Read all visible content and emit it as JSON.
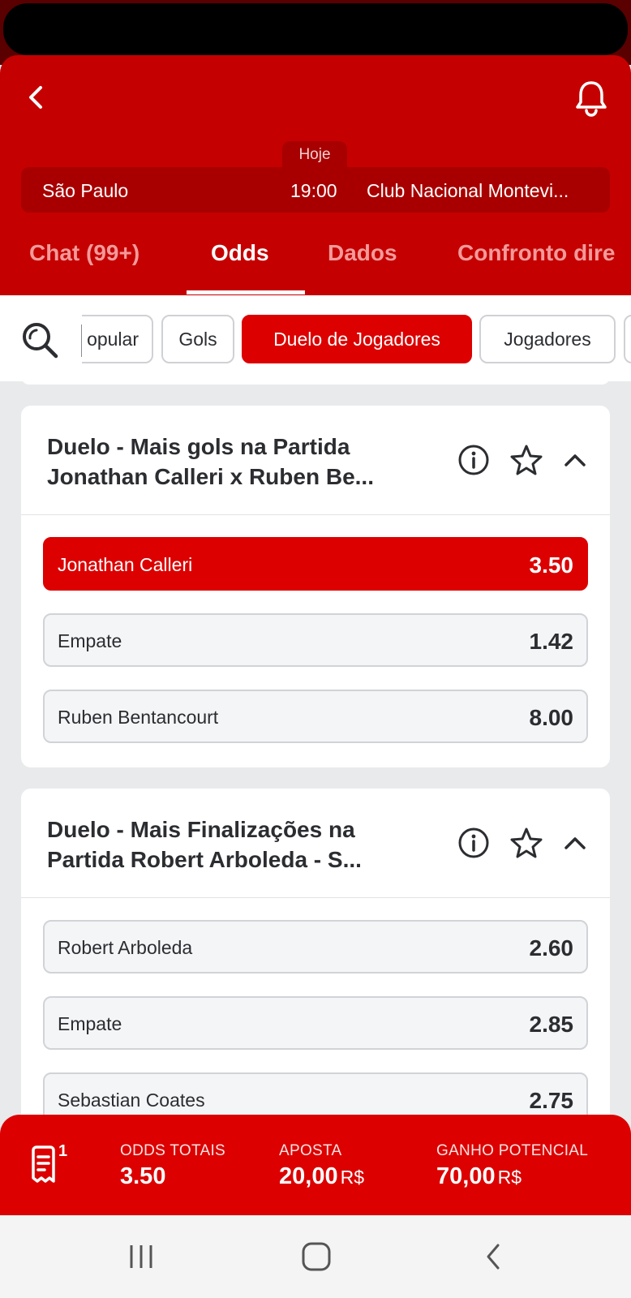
{
  "match": {
    "day": "Hoje",
    "home_team": "São Paulo",
    "time": "19:00",
    "away_team": "Club Nacional Montevi..."
  },
  "tabs": [
    {
      "label": "Chat (99+)"
    },
    {
      "label": "Odds"
    },
    {
      "label": "Dados"
    },
    {
      "label": "Confronto dire"
    }
  ],
  "filters": [
    {
      "label": "opular"
    },
    {
      "label": "Gols"
    },
    {
      "label": "Duelo de Jogadores"
    },
    {
      "label": "Jogadores"
    }
  ],
  "markets": [
    {
      "title_line1": "Duelo - Mais gols na Partida",
      "title_line2": "Jonathan Calleri x Ruben Be...",
      "options": [
        {
          "label": "Jonathan Calleri",
          "odd": "3.50"
        },
        {
          "label": "Empate",
          "odd": "1.42"
        },
        {
          "label": "Ruben Bentancourt",
          "odd": "8.00"
        }
      ]
    },
    {
      "title_line1": "Duelo - Mais Finalizações na",
      "title_line2": "Partida Robert Arboleda - S...",
      "options": [
        {
          "label": "Robert Arboleda",
          "odd": "2.60"
        },
        {
          "label": "Empate",
          "odd": "2.85"
        },
        {
          "label": "Sebastian Coates",
          "odd": "2.75"
        }
      ]
    }
  ],
  "betslip": {
    "count": "1",
    "odds_label": "ODDS TOTAIS",
    "odds_value": "3.50",
    "stake_label": "APOSTA",
    "stake_value": "20,00",
    "stake_currency": "R$",
    "payout_label": "GANHO POTENCIAL",
    "payout_value": "70,00",
    "payout_currency": "R$"
  },
  "icons": {
    "back": "chevron-left-icon",
    "notifications": "bell-icon",
    "search": "search-icon",
    "info": "info-icon",
    "favorite": "star-icon",
    "collapse": "chevron-up-icon",
    "betslip": "receipt-icon"
  },
  "colors": {
    "brand_red": "#c50000",
    "accent_red": "#dc0000",
    "background": "#e9eaec"
  }
}
